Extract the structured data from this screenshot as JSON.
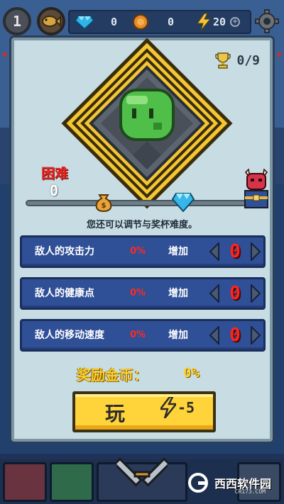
{
  "topbar": {
    "level": "1",
    "gems": "0",
    "coins": "0",
    "energy": "20"
  },
  "modal": {
    "trophy_count": "0/9",
    "difficulty_label": "困难",
    "difficulty_value": "0",
    "adjust_hint": "您还可以调节与奖杯难度。",
    "modifiers": [
      {
        "label": "敌人的攻击力",
        "percent": "0%",
        "increase_label": "增加",
        "value": "0"
      },
      {
        "label": "敌人的健康点",
        "percent": "0%",
        "increase_label": "增加",
        "value": "0"
      },
      {
        "label": "敌人的移动速度",
        "percent": "0%",
        "increase_label": "增加",
        "value": "0"
      }
    ],
    "reward_label": "奖励金币：",
    "reward_value": "0%",
    "play_label": "玩",
    "play_cost": "-5"
  },
  "bottom": {
    "watermark": "西西软件园",
    "watermark_sub": "CR173.COM"
  },
  "colors": {
    "modal_bg": "#c7dde3",
    "row_bg": "#2f4f96",
    "accent_red": "#ff241c",
    "gold": "#ffcf2e",
    "play_yellow": "#ffd43a"
  },
  "icons": [
    "level-badge",
    "fish-icon",
    "gem-icon",
    "coin-icon",
    "lightning-icon",
    "plus-icon",
    "gear-icon",
    "trophy-icon",
    "slime-boss-icon",
    "coin-bag-icon",
    "diamond-icon",
    "demon-chest-icon",
    "arrow-left-icon",
    "arrow-right-icon",
    "crossed-swords-icon"
  ]
}
